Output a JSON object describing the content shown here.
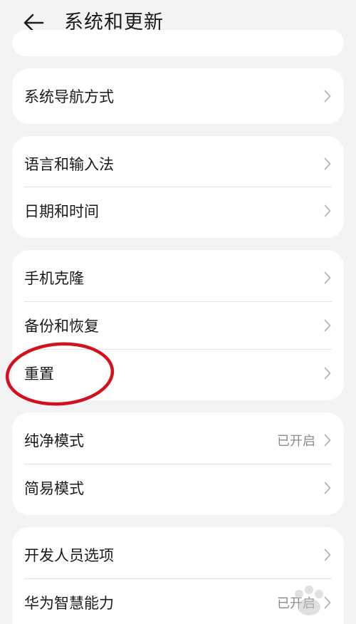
{
  "header": {
    "title": "系统和更新",
    "back_icon": "arrow-left-icon"
  },
  "colors": {
    "background": "#f1f3f5",
    "card": "#ffffff",
    "text_primary": "#1a1a1a",
    "text_secondary": "#8a8a8a",
    "chevron": "#b5b5b5",
    "annotation": "#d4101c"
  },
  "groups": [
    {
      "items": [
        {
          "label": "系统导航方式",
          "value": ""
        }
      ]
    },
    {
      "items": [
        {
          "label": "语言和输入法",
          "value": ""
        },
        {
          "label": "日期和时间",
          "value": ""
        }
      ]
    },
    {
      "items": [
        {
          "label": "手机克隆",
          "value": ""
        },
        {
          "label": "备份和恢复",
          "value": ""
        },
        {
          "label": "重置",
          "value": ""
        }
      ]
    },
    {
      "items": [
        {
          "label": "纯净模式",
          "value": "已开启"
        },
        {
          "label": "简易模式",
          "value": ""
        }
      ]
    },
    {
      "items": [
        {
          "label": "开发人员选项",
          "value": ""
        },
        {
          "label": "华为智慧能力",
          "value": "已开启"
        }
      ]
    }
  ]
}
